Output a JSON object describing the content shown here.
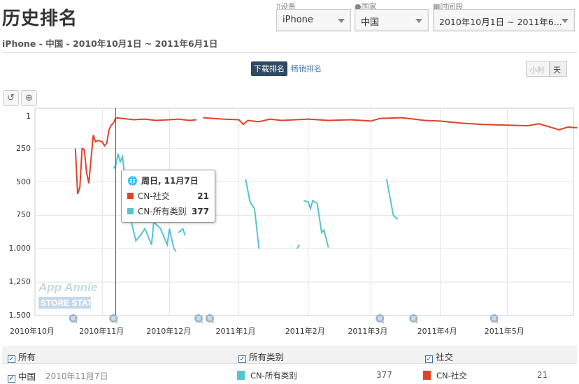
{
  "header": {
    "title": "历史排名",
    "subtitle": "iPhone - 中国 - 2010年10月1日 ~ 2011年6月1日"
  },
  "filters": {
    "device": {
      "label": "设备",
      "value": "iPhone",
      "icon": "phone-icon"
    },
    "country": {
      "label": "国家",
      "value": "中国",
      "icon": "globe-icon"
    },
    "period": {
      "label": "时间段",
      "value": "2010年10月1日 ~ 2011年6...",
      "icon": "calendar-icon"
    }
  },
  "tabs": [
    {
      "label": "下载排名",
      "active": true
    },
    {
      "label": "畅销排名",
      "active": false
    }
  ],
  "granularity": [
    {
      "label": "小时",
      "active": false
    },
    {
      "label": "天",
      "active": true
    }
  ],
  "tools": [
    {
      "icon": "reset-icon"
    },
    {
      "icon": "zoom-in-icon"
    }
  ],
  "watermark": {
    "line1": "App Annie",
    "line2": "STORE STATS"
  },
  "tooltip": {
    "date": "周日, 11月7日",
    "rows": [
      {
        "name": "CN-社交",
        "value": "21",
        "color": "#e0412a"
      },
      {
        "name": "CN-所有类别",
        "value": "377",
        "color": "#55c4cf"
      }
    ]
  },
  "legend": {
    "headers": [
      "所有",
      "所有类别",
      "社交"
    ],
    "row": {
      "country": "中国",
      "date": "2010年11月7日",
      "items": [
        {
          "name": "CN-所有类别",
          "value": "377",
          "color": "#55c4cf"
        },
        {
          "name": "CN-社交",
          "value": "21",
          "color": "#e0412a"
        }
      ]
    }
  },
  "chart_data": {
    "type": "line",
    "xlabel": "",
    "ylabel": "",
    "x_range": [
      "2010-10-01",
      "2011-06-01"
    ],
    "y_range": [
      1,
      1500
    ],
    "y_inverted": true,
    "y_ticks": [
      "1",
      "250",
      "500",
      "750",
      "1,000",
      "1,250",
      "1,500"
    ],
    "y_tick_values": [
      1,
      250,
      500,
      750,
      1000,
      1250,
      1500
    ],
    "x_ticks": [
      "2010年10月",
      "2010年11月",
      "2010年12月",
      "2011年1月",
      "2011年2月",
      "2011年3月",
      "2011年4月",
      "2011年5月"
    ],
    "x_tick_dates": [
      "2010-10-01",
      "2010-11-01",
      "2010-12-01",
      "2011-01-01",
      "2011-02-01",
      "2011-03-01",
      "2011-04-01",
      "2011-05-01"
    ],
    "grid": true,
    "crosshair_date": "2010-11-07",
    "annotation_dates": [
      "2010-10-19",
      "2010-11-06",
      "2010-12-14",
      "2010-12-19",
      "2011-03-05",
      "2011-03-20",
      "2011-04-25"
    ],
    "series": [
      {
        "name": "CN-社交",
        "color": "#e0412a",
        "points": [
          [
            "2010-10-20",
            250
          ],
          [
            "2010-10-21",
            590
          ],
          [
            "2010-10-22",
            540
          ],
          [
            "2010-10-23",
            250
          ],
          [
            "2010-10-24",
            260
          ],
          [
            "2010-10-25",
            430
          ],
          [
            "2010-10-26",
            510
          ],
          [
            "2010-10-28",
            150
          ],
          [
            "2010-10-29",
            200
          ],
          [
            "2010-10-30",
            190
          ],
          [
            "2010-11-01",
            200
          ],
          [
            "2010-11-02",
            230
          ],
          [
            "2010-11-03",
            210
          ],
          [
            "2010-11-04",
            110
          ],
          [
            "2010-11-05",
            75
          ],
          [
            "2010-11-06",
            60
          ],
          [
            "2010-11-07",
            21
          ],
          [
            "2010-11-10",
            25
          ],
          [
            "2010-11-15",
            35
          ],
          [
            "2010-11-20",
            30
          ],
          [
            "2010-11-25",
            40
          ],
          [
            "2010-12-01",
            35
          ],
          [
            "2010-12-05",
            30
          ],
          [
            "2010-12-10",
            40
          ],
          [
            "2010-12-13",
            35
          ],
          null,
          [
            "2010-12-16",
            20
          ],
          [
            "2010-12-25",
            30
          ],
          [
            "2011-01-01",
            35
          ],
          [
            "2011-01-03",
            70
          ],
          [
            "2011-01-05",
            40
          ],
          [
            "2011-01-10",
            50
          ],
          [
            "2011-01-15",
            30
          ],
          [
            "2011-01-20",
            40
          ],
          [
            "2011-02-01",
            30
          ],
          [
            "2011-02-10",
            40
          ],
          [
            "2011-02-20",
            35
          ],
          [
            "2011-03-01",
            45
          ],
          [
            "2011-03-05",
            25
          ],
          [
            "2011-03-15",
            20
          ],
          [
            "2011-03-25",
            40
          ],
          [
            "2011-04-01",
            45
          ],
          [
            "2011-04-10",
            60
          ],
          [
            "2011-04-20",
            70
          ],
          [
            "2011-05-01",
            75
          ],
          [
            "2011-05-10",
            80
          ],
          [
            "2011-05-15",
            65
          ],
          [
            "2011-05-20",
            90
          ],
          [
            "2011-05-24",
            110
          ],
          [
            "2011-05-28",
            90
          ],
          [
            "2011-06-01",
            95
          ]
        ]
      },
      {
        "name": "CN-所有类别",
        "color": "#55c4cf",
        "points": [
          [
            "2010-11-06",
            400
          ],
          [
            "2010-11-07",
            377
          ],
          [
            "2010-11-08",
            290
          ],
          [
            "2010-11-09",
            350
          ],
          [
            "2010-11-10",
            310
          ],
          [
            "2010-11-12",
            600
          ],
          [
            "2010-11-14",
            800
          ],
          [
            "2010-11-16",
            940
          ],
          [
            "2010-11-18",
            900
          ],
          [
            "2010-11-20",
            850
          ],
          [
            "2010-11-23",
            970
          ],
          [
            "2010-11-24",
            800
          ],
          [
            "2010-11-27",
            850
          ],
          [
            "2010-11-30",
            970
          ],
          [
            "2010-12-01",
            850
          ],
          [
            "2010-12-03",
            1000
          ],
          [
            "2010-12-04",
            1020
          ],
          null,
          [
            "2010-12-05",
            880
          ],
          [
            "2010-12-07",
            850
          ],
          [
            "2010-12-08",
            900
          ],
          null,
          [
            "2011-01-04",
            480
          ],
          [
            "2011-01-06",
            650
          ],
          [
            "2011-01-08",
            700
          ],
          [
            "2011-01-10",
            1000
          ],
          null,
          [
            "2011-01-27",
            1000
          ],
          [
            "2011-01-28",
            970
          ],
          null,
          [
            "2011-01-30",
            640
          ],
          [
            "2011-02-01",
            650
          ],
          [
            "2011-02-02",
            700
          ],
          [
            "2011-02-03",
            640
          ],
          [
            "2011-02-05",
            660
          ],
          [
            "2011-02-07",
            880
          ],
          [
            "2011-02-08",
            860
          ],
          [
            "2011-02-10",
            990
          ],
          null,
          [
            "2011-03-08",
            480
          ],
          [
            "2011-03-11",
            750
          ],
          [
            "2011-03-13",
            780
          ]
        ]
      }
    ]
  }
}
